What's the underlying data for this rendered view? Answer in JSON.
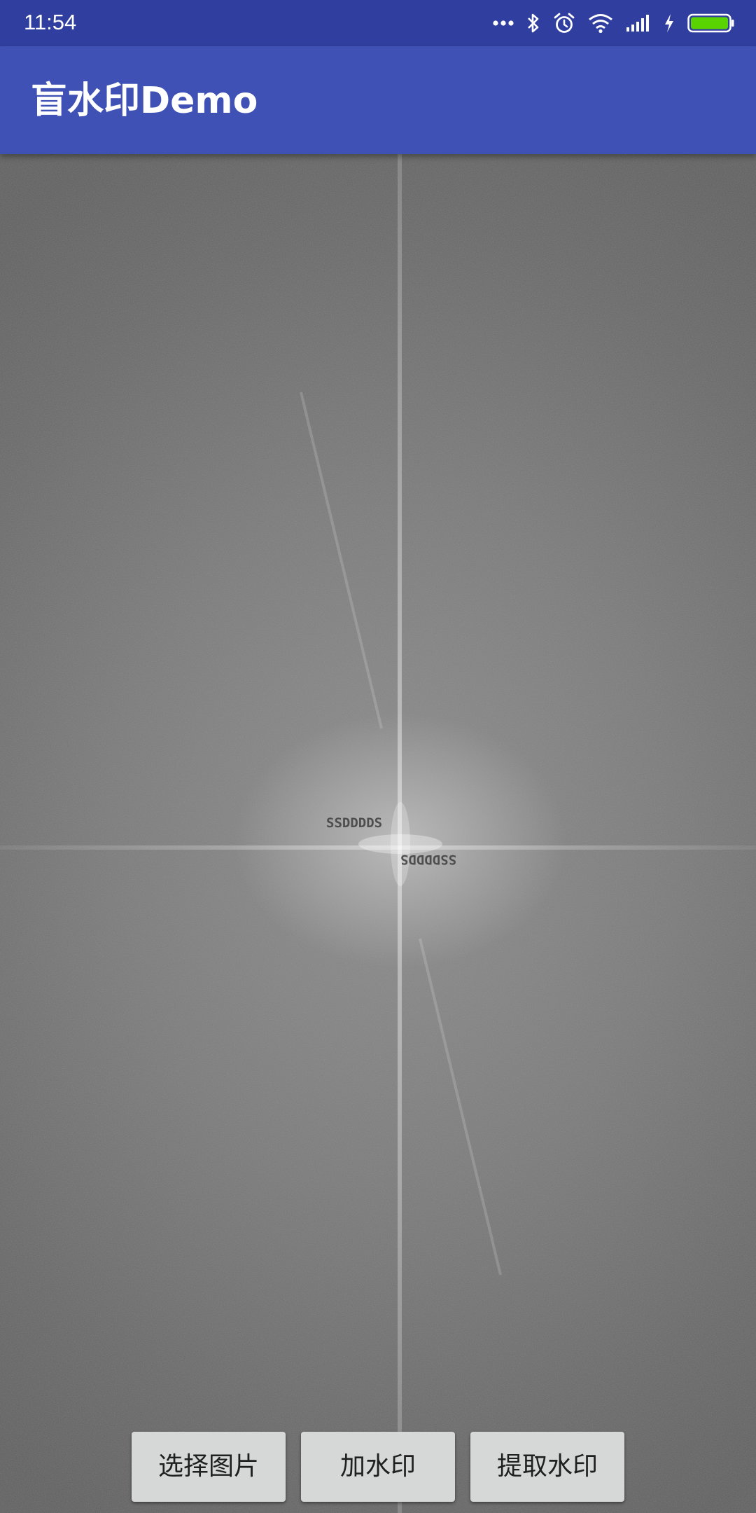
{
  "status_bar": {
    "time": "11:54",
    "icons": [
      "more-dots-icon",
      "bluetooth-icon",
      "alarm-icon",
      "wifi-icon",
      "signal-icon",
      "charging-icon",
      "battery-icon"
    ],
    "battery_color": "#5ad400"
  },
  "app_bar": {
    "title": "盲水印Demo",
    "color": "#3f51b5"
  },
  "image_view": {
    "watermark_text_1": "SSDDDDS",
    "watermark_text_2": "SSDDDDS"
  },
  "buttons": {
    "select_image": "选择图片",
    "add_watermark": "加水印",
    "extract_watermark": "提取水印"
  }
}
